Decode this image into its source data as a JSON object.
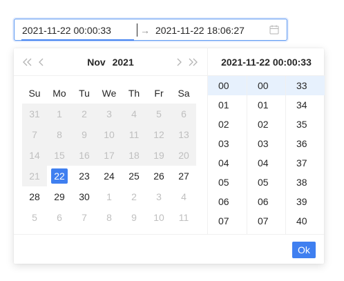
{
  "range": {
    "start_value": "2021-11-22 00:00:33",
    "end_value": "2021-11-22 18:06:27",
    "separator": "→"
  },
  "calendar": {
    "month": "Nov",
    "year": "2021",
    "weekdays": [
      "Su",
      "Mo",
      "Tu",
      "We",
      "Th",
      "Fr",
      "Sa"
    ],
    "weeks": [
      [
        {
          "d": "31",
          "s": "disabled"
        },
        {
          "d": "1",
          "s": "disabled"
        },
        {
          "d": "2",
          "s": "disabled"
        },
        {
          "d": "3",
          "s": "disabled"
        },
        {
          "d": "4",
          "s": "disabled"
        },
        {
          "d": "5",
          "s": "disabled"
        },
        {
          "d": "6",
          "s": "disabled"
        }
      ],
      [
        {
          "d": "7",
          "s": "disabled"
        },
        {
          "d": "8",
          "s": "disabled"
        },
        {
          "d": "9",
          "s": "disabled"
        },
        {
          "d": "10",
          "s": "disabled"
        },
        {
          "d": "11",
          "s": "disabled"
        },
        {
          "d": "12",
          "s": "disabled"
        },
        {
          "d": "13",
          "s": "disabled"
        }
      ],
      [
        {
          "d": "14",
          "s": "disabled"
        },
        {
          "d": "15",
          "s": "disabled"
        },
        {
          "d": "16",
          "s": "disabled"
        },
        {
          "d": "17",
          "s": "disabled"
        },
        {
          "d": "18",
          "s": "disabled"
        },
        {
          "d": "19",
          "s": "disabled"
        },
        {
          "d": "20",
          "s": "disabled"
        }
      ],
      [
        {
          "d": "21",
          "s": "disabled"
        },
        {
          "d": "22",
          "s": "selected"
        },
        {
          "d": "23",
          "s": ""
        },
        {
          "d": "24",
          "s": ""
        },
        {
          "d": "25",
          "s": ""
        },
        {
          "d": "26",
          "s": ""
        },
        {
          "d": "27",
          "s": ""
        }
      ],
      [
        {
          "d": "28",
          "s": ""
        },
        {
          "d": "29",
          "s": ""
        },
        {
          "d": "30",
          "s": ""
        },
        {
          "d": "1",
          "s": "muted"
        },
        {
          "d": "2",
          "s": "muted"
        },
        {
          "d": "3",
          "s": "muted"
        },
        {
          "d": "4",
          "s": "muted"
        }
      ],
      [
        {
          "d": "5",
          "s": "muted"
        },
        {
          "d": "6",
          "s": "muted"
        },
        {
          "d": "7",
          "s": "muted"
        },
        {
          "d": "8",
          "s": "muted"
        },
        {
          "d": "9",
          "s": "muted"
        },
        {
          "d": "10",
          "s": "muted"
        },
        {
          "d": "11",
          "s": "muted"
        }
      ]
    ]
  },
  "time": {
    "header": "2021-11-22 00:00:33",
    "hours": [
      "00",
      "01",
      "02",
      "03",
      "04",
      "05",
      "06",
      "07"
    ],
    "minutes": [
      "00",
      "01",
      "02",
      "03",
      "04",
      "05",
      "06",
      "07"
    ],
    "seconds": [
      "33",
      "34",
      "35",
      "36",
      "37",
      "38",
      "39",
      "40"
    ],
    "selected_hour": "00",
    "selected_minute": "00",
    "selected_second": "33"
  },
  "footer": {
    "ok_label": "Ok"
  },
  "colors": {
    "accent": "#3f7ff0",
    "disabled_bg": "#f2f2f2",
    "time_selected_bg": "#e7f1fd"
  },
  "icons": {
    "calendar": "calendar-icon",
    "super_prev": "double-chevron-left-icon",
    "prev": "chevron-left-icon",
    "next": "chevron-right-icon",
    "super_next": "double-chevron-right-icon"
  }
}
